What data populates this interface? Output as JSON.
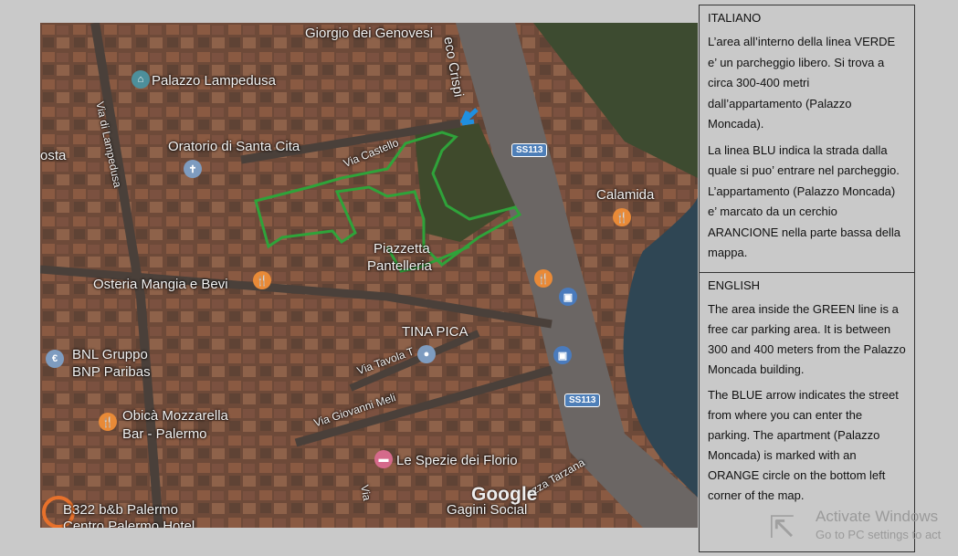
{
  "map": {
    "labels": {
      "genovesi": "Giorgio dei Genovesi",
      "crispi": "eco Crispi",
      "lampedusa_palace": "Palazzo Lampedusa",
      "via_lampedusa": "Via di Lampedusa",
      "oratorio": "Oratorio di Santa Cita",
      "costa": "osta",
      "via_castello": "Via Castello",
      "piazzetta": "Piazzetta",
      "pantelleria": "Pantelleria",
      "calamida": "Calamida",
      "osteria": "Osteria Mangia e Bevi",
      "tina_pica": "TINA PICA",
      "via_tavola": "Via Tavola T",
      "bnl1": "BNL Gruppo",
      "bnl2": "BNP Paribas",
      "obica1": "Obicà Mozzarella",
      "obica2": "Bar - Palermo",
      "via_meli": "Via Giovanni Meli",
      "spezie": "Le Spezie dei Florio",
      "gagini": "Gagini Social",
      "tarzana": "azza Tarzana",
      "via_short": "Via",
      "b322": "B322 b&b Palermo",
      "centro": "Centro Palermo Hotel",
      "google": "Google"
    },
    "shields": [
      "SS113",
      "SS113"
    ],
    "route_colors": {
      "parking_outline": "#2fa33a",
      "entry_arrow": "#1f8fe0",
      "apartment_circle": "#e8712b"
    }
  },
  "doc": {
    "italian": {
      "title": "ITALIANO",
      "p1": "L’area all’interno della linea VERDE e’ un parcheggio libero. Si trova a circa 300-400 metri dall’appartamento (Palazzo Moncada).",
      "p2": "La linea BLU indica la strada dalla quale si puo’ entrare nel parcheggio. L’appartamento (Palazzo Moncada) e’ marcato da un cerchio ARANCIONE nella parte bassa della mappa."
    },
    "english": {
      "title": "ENGLISH",
      "p1": "The area inside the GREEN line is a free car parking area. It is between 300 and 400 meters from the Palazzo Moncada building.",
      "p2": "The BLUE arrow indicates the street from where you can enter the parking. The apartment (Palazzo Moncada) is marked with an ORANGE circle on the bottom left corner of the map."
    }
  },
  "watermark": {
    "line1": "Activate Windows",
    "line2": "Go to PC settings to act"
  }
}
